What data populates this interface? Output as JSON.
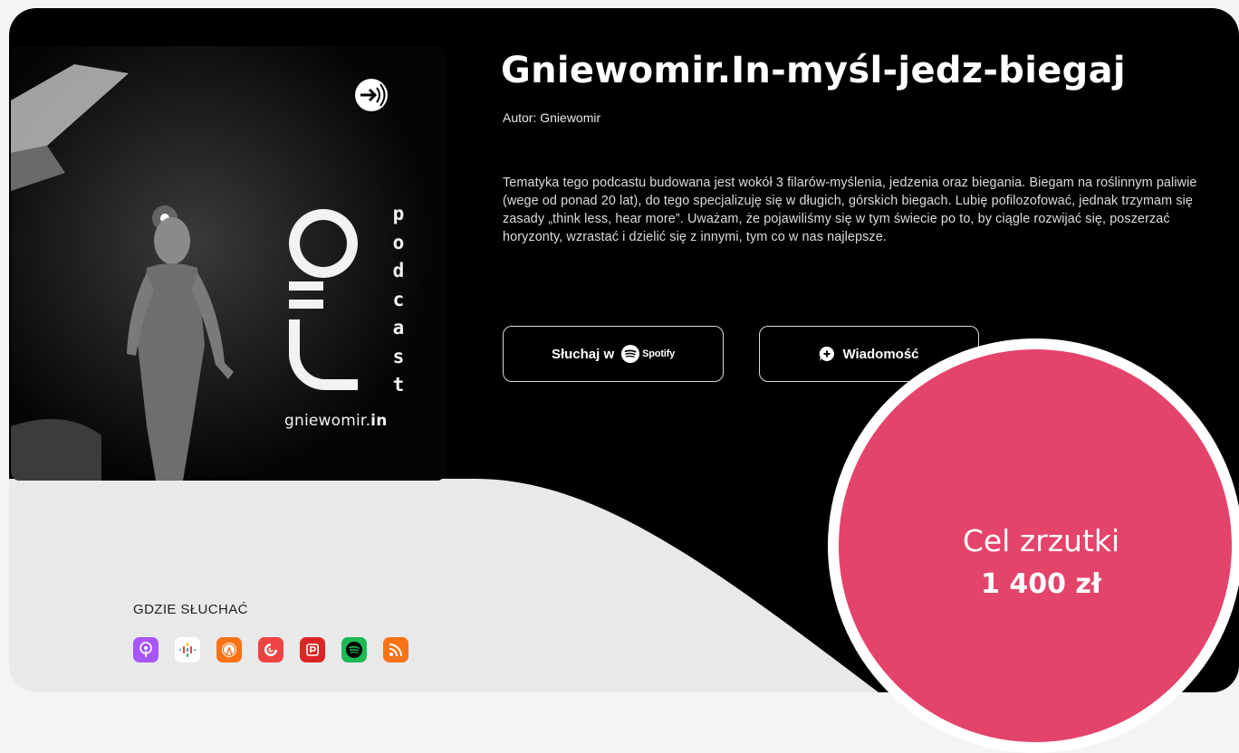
{
  "podcast": {
    "title": "Gniewomir.In-myśl-jedz-biegaj",
    "author": "Autor: Gniewomir",
    "description": "Tematyka tego podcastu budowana jest wokół 3 filarów-myślenia, jedzenia oraz biegania. Biegam na roślinnym paliwie (wege od ponad 20 lat), do tego specjalizuję się w długich, górskich biegach. Lubię pofilozofować, jednak trzymam się zasady „think less, hear more”. Uważam, że pojawiliśmy się w tym świecie po to, by ciągle rozwijać się, poszerzać horyzonty, wzrastać i dzielić się z innymi, tym co w nas najlepsze."
  },
  "cover": {
    "url_text": "gniewomir.",
    "url_suffix": "in",
    "vertical_letters": [
      "p",
      "o",
      "d",
      "c",
      "a",
      "s",
      "t"
    ]
  },
  "buttons": {
    "listen_label": "Słuchaj w",
    "spotify_brand": "Spotify",
    "message_label": "Wiadomość"
  },
  "listen_on": {
    "label": "GDZIE SŁUCHAĆ",
    "platforms": [
      {
        "icon": "apple-podcasts-icon",
        "color": "#a855f7"
      },
      {
        "icon": "google-podcasts-icon",
        "color": "#ffffff"
      },
      {
        "icon": "overcast-icon",
        "color": "#f97316"
      },
      {
        "icon": "pocket-casts-icon",
        "color": "#ef4444"
      },
      {
        "icon": "podcast-addict-icon",
        "color": "#dc2626"
      },
      {
        "icon": "spotify-icon",
        "color": "#1db954"
      },
      {
        "icon": "rss-icon",
        "color": "#f97316"
      }
    ]
  },
  "goal": {
    "label": "Cel zrzutki",
    "amount": "1 400 zł"
  },
  "colors": {
    "accent": "#e4436a",
    "hero_background": "#000000",
    "card_background": "#e9e9ea"
  }
}
